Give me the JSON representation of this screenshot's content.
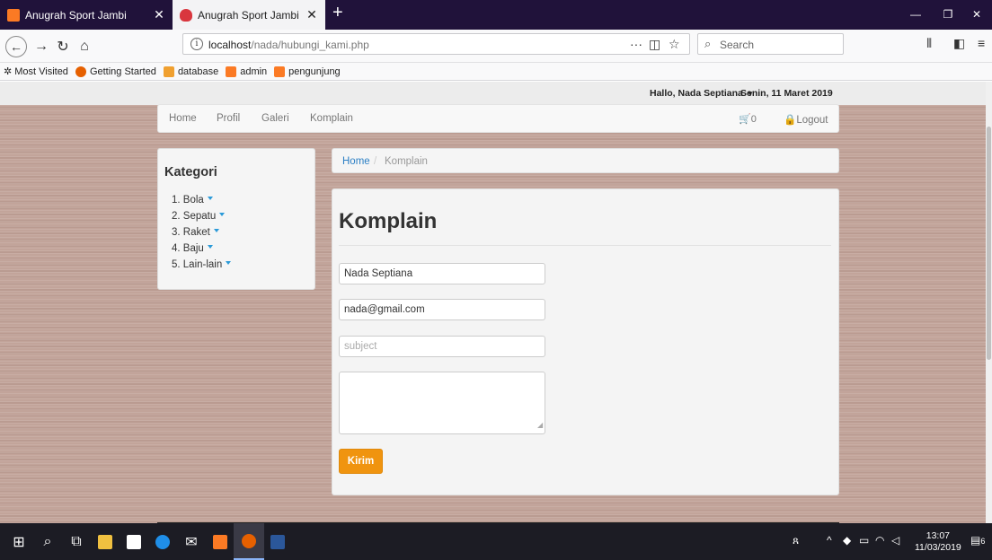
{
  "browser": {
    "tabs": [
      {
        "title": "Anugrah Sport Jambi",
        "active": false
      },
      {
        "title": "Anugrah Sport Jambi",
        "active": true
      }
    ],
    "new_tab": "+",
    "url_host": "localhost",
    "url_path": "/nada/hubungi_kami.php",
    "search_placeholder": "Search",
    "bookmarks": [
      {
        "label": "Most Visited",
        "icon": "gear-icon"
      },
      {
        "label": "Getting Started",
        "icon": "firefox-icon"
      },
      {
        "label": "database",
        "icon": "phpmyadmin-icon"
      },
      {
        "label": "admin",
        "icon": "xampp-icon"
      },
      {
        "label": "pengunjung",
        "icon": "xampp-icon"
      }
    ]
  },
  "page": {
    "greeting": "Hallo, Nada Septiana",
    "date": "Senin, 11 Maret 2019",
    "nav": {
      "links": [
        "Home",
        "Profil",
        "Galeri",
        "Komplain"
      ],
      "cart_count": "0",
      "logout": "Logout"
    },
    "sidebar": {
      "title": "Kategori",
      "items": [
        "1. Bola",
        "2. Sepatu",
        "3. Raket",
        "4. Baju",
        "5. Lain-lain"
      ]
    },
    "breadcrumb": {
      "home": "Home",
      "separator": "/",
      "current": "Komplain"
    },
    "form": {
      "heading": "Komplain",
      "name_value": "Nada Septiana",
      "email_value": "nada@gmail.com",
      "subject_placeholder": "subject",
      "message_value": "",
      "submit_label": "Kirim"
    }
  },
  "taskbar": {
    "time": "13:07",
    "date": "11/03/2019",
    "notification_count": "6"
  },
  "colors": {
    "accent": "#f0940f",
    "link": "#2b7fc4",
    "titlebar": "#20123a"
  }
}
